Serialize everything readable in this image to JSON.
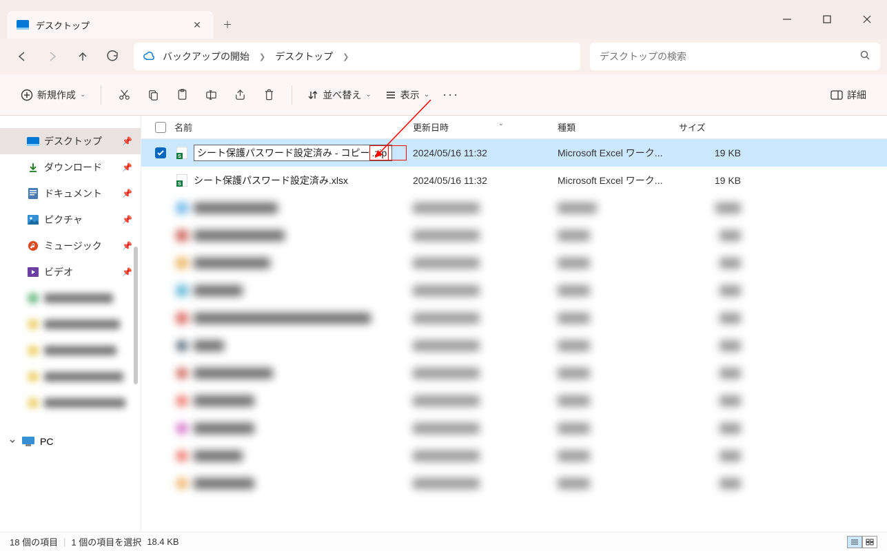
{
  "window": {
    "title": "デスクトップ"
  },
  "toolbar": {
    "new_label": "新規作成",
    "sort_label": "並べ替え",
    "view_label": "表示",
    "details_label": "詳細"
  },
  "addressbar": {
    "segment1": "バックアップの開始",
    "segment2": "デスクトップ"
  },
  "search": {
    "placeholder": "デスクトップの検索"
  },
  "sidebar": {
    "items": [
      {
        "label": "デスクトップ",
        "icon": "desktop",
        "pinned": true,
        "active": true
      },
      {
        "label": "ダウンロード",
        "icon": "download",
        "pinned": true
      },
      {
        "label": "ドキュメント",
        "icon": "document",
        "pinned": true
      },
      {
        "label": "ピクチャ",
        "icon": "picture",
        "pinned": true
      },
      {
        "label": "ミュージック",
        "icon": "music",
        "pinned": true
      },
      {
        "label": "ビデオ",
        "icon": "video",
        "pinned": true
      }
    ],
    "pc_label": "PC"
  },
  "columns": {
    "name": "名前",
    "date": "更新日時",
    "type": "種類",
    "size": "サイズ"
  },
  "files": [
    {
      "name_base": "シート保護パスワード設定済み - コピー",
      "name_ext": ".zip",
      "date": "2024/05/16 11:32",
      "type": "Microsoft Excel ワーク...",
      "size": "19 KB",
      "selected": true,
      "renaming": true
    },
    {
      "name": "シート保護パスワード設定済み.xlsx",
      "date": "2024/05/16 11:32",
      "type": "Microsoft Excel ワーク...",
      "size": "19 KB"
    }
  ],
  "statusbar": {
    "count": "18 個の項目",
    "selection": "1 個の項目を選択",
    "sel_size": "18.4 KB"
  }
}
